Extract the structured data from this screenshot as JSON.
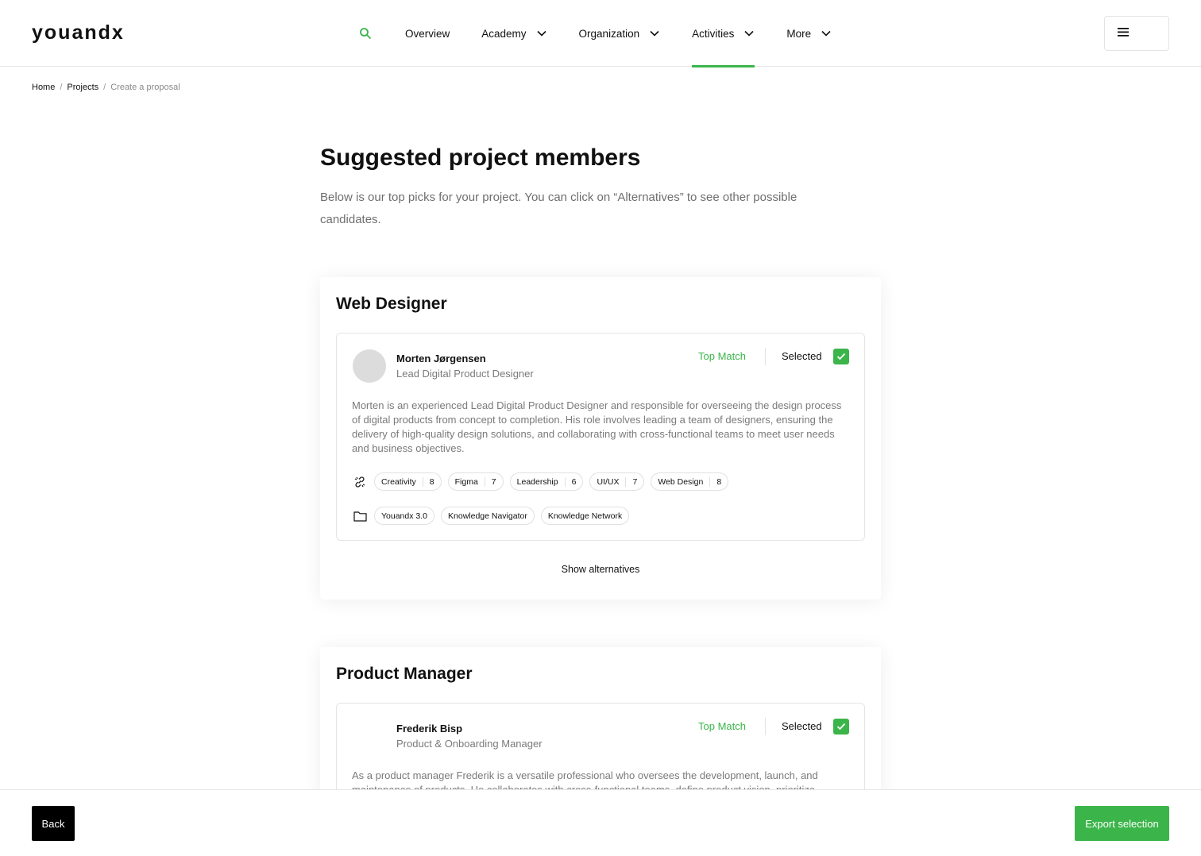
{
  "brand": {
    "logo": "youandx",
    "accent_color": "#3bb54a"
  },
  "nav": {
    "search_icon": "search-icon",
    "items": [
      {
        "label": "Overview",
        "has_dropdown": false,
        "active": false
      },
      {
        "label": "Academy",
        "has_dropdown": true,
        "active": false
      },
      {
        "label": "Organization",
        "has_dropdown": true,
        "active": false
      },
      {
        "label": "Activities",
        "has_dropdown": true,
        "active": true
      },
      {
        "label": "More",
        "has_dropdown": true,
        "active": false
      }
    ],
    "menu_icon": "hamburger-menu-icon"
  },
  "breadcrumb": [
    {
      "label": "Home"
    },
    {
      "label": "Projects"
    },
    {
      "label": "Create a proposal"
    }
  ],
  "page": {
    "title": "Suggested project members",
    "subtitle": "Below is our top picks for your project. You can click on “Alternatives” to see other possible candidates."
  },
  "sections": [
    {
      "role_title": "Web Designer",
      "candidate": {
        "name": "Morten Jørgensen",
        "role": "Lead Digital Product Designer",
        "match": "Top Match",
        "selected_label": "Selected",
        "selected": true,
        "description": "Morten is an experienced Lead Digital Product Designer and responsible for overseeing the design process of digital products from concept to completion. His role involves leading a team of designers, ensuring the delivery of high-quality design solutions, and collaborating with cross-functional teams to meet user needs and business objectives.",
        "skills": [
          {
            "name": "Creativity",
            "score": "8"
          },
          {
            "name": "Figma",
            "score": "7"
          },
          {
            "name": "Leadership",
            "score": "6"
          },
          {
            "name": "UI/UX",
            "score": "7"
          },
          {
            "name": "Web Design",
            "score": "8"
          }
        ],
        "projects": [
          "Youandx 3.0",
          "Knowledge Navigator",
          "Knowledge Network"
        ]
      },
      "show_alternatives": "Show alternatives"
    },
    {
      "role_title": "Product Manager",
      "candidate": {
        "name": "Frederik Bisp",
        "role": "Product & Onboarding Manager",
        "match": "Top Match",
        "selected_label": "Selected",
        "selected": true,
        "description": "As a product manager Frederik is a versatile professional who oversees the development, launch, and maintenance of products. He collaborates with cross-functional teams, define product vision, prioritize"
      }
    }
  ],
  "footer": {
    "back_label": "Back",
    "export_label": "Export selection"
  }
}
